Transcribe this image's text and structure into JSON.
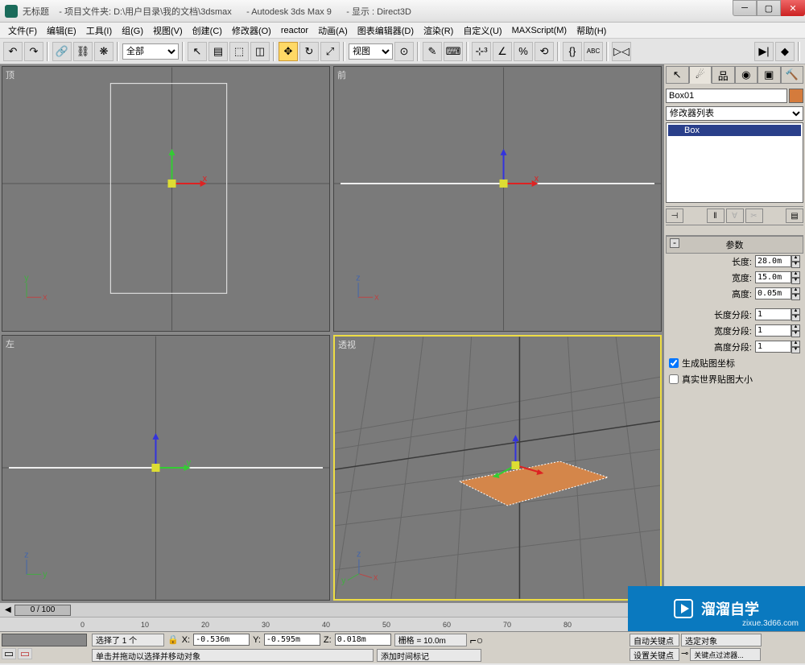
{
  "window": {
    "title_untitled": "无标题",
    "title_project": "- 项目文件夹: D:\\用户目录\\我的文档\\3dsmax",
    "title_app": "- Autodesk 3ds Max 9",
    "title_display": "- 显示 : Direct3D"
  },
  "menu": {
    "file": "文件(F)",
    "edit": "编辑(E)",
    "tools": "工具(I)",
    "group": "组(G)",
    "views": "视图(V)",
    "create": "创建(C)",
    "modifiers": "修改器(O)",
    "reactor": "reactor",
    "animation": "动画(A)",
    "graph": "图表编辑器(D)",
    "render": "渲染(R)",
    "customize": "自定义(U)",
    "maxscript": "MAXScript(M)",
    "help": "帮助(H)"
  },
  "toolbar": {
    "filter": "全部",
    "view_select": "视图"
  },
  "viewports": {
    "top": "顶",
    "front": "前",
    "left": "左",
    "perspective": "透视"
  },
  "panel": {
    "object_name": "Box01",
    "modifier_list": "修改器列表",
    "stack_item": "Box",
    "rollout_params": "参数",
    "length": "长度:",
    "length_val": "28.0m",
    "width": "宽度:",
    "width_val": "15.0m",
    "height": "高度:",
    "height_val": "0.05m",
    "lsegs": "长度分段:",
    "lsegs_val": "1",
    "wsegs": "宽度分段:",
    "wsegs_val": "1",
    "hsegs": "高度分段:",
    "hsegs_val": "1",
    "gen_map": "生成贴图坐标",
    "real_world": "真实世界贴图大小"
  },
  "time": {
    "slider": "0 / 100"
  },
  "ruler": {
    "t0": "0",
    "t10": "10",
    "t20": "20",
    "t30": "30",
    "t40": "40",
    "t50": "50",
    "t60": "60",
    "t70": "70",
    "t80": "80"
  },
  "status": {
    "selected": "选择了 1 个",
    "click_drag": "单击并拖动以选择并移动对象",
    "x_label": "X:",
    "x_val": "-0.536m",
    "y_label": "Y:",
    "y_val": "-0.595m",
    "z_label": "Z:",
    "z_val": "0.018m",
    "grid": "栅格 = 10.0m",
    "add_time_tag": "添加时间标记",
    "auto_key": "自动关键点",
    "set_key": "设置关键点",
    "sel_obj": "选定对象",
    "key_filter": "关键点过滤器..."
  },
  "watermark": {
    "text": "溜溜自学",
    "url": "zixue.3d66.com"
  }
}
